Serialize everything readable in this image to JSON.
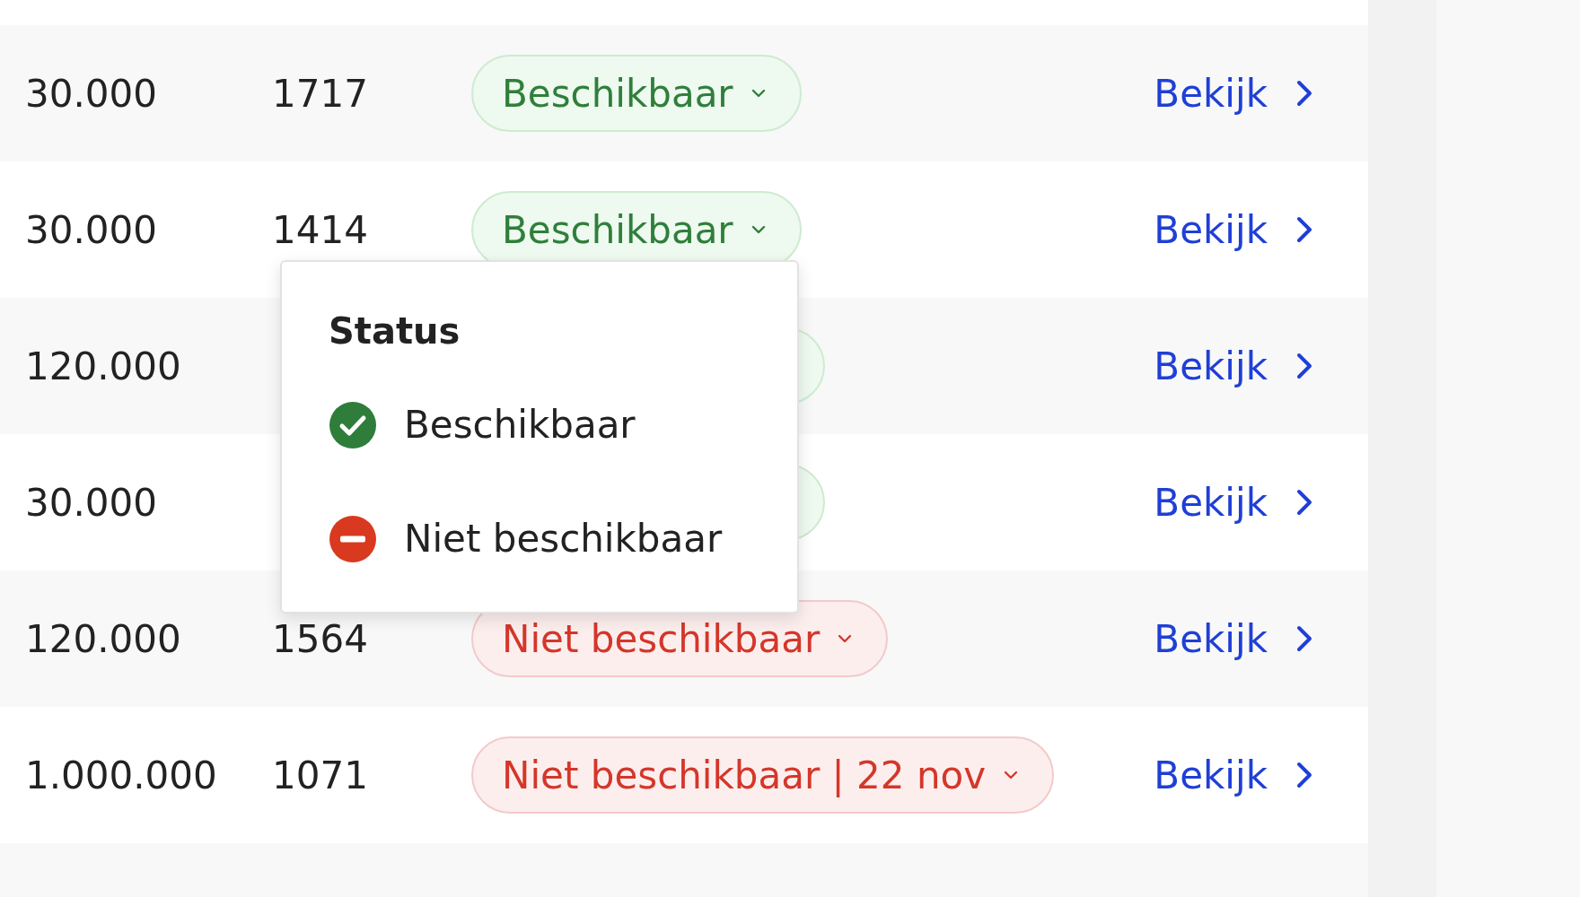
{
  "rows": [
    {
      "amount": "30.000",
      "number": "1717",
      "status": {
        "kind": "available",
        "label": "Beschikbaar"
      },
      "link": "Bekijk"
    },
    {
      "amount": "30.000",
      "number": "1414",
      "status": {
        "kind": "available",
        "label": "Beschikbaar"
      },
      "link": "Bekijk"
    },
    {
      "amount": "120.000",
      "status": {
        "kind": "available"
      },
      "link": "Bekijk"
    },
    {
      "amount": "30.000",
      "status": {
        "kind": "available"
      },
      "link": "Bekijk"
    },
    {
      "amount": "120.000",
      "number": "1564",
      "status": {
        "kind": "unavailable",
        "label": "Niet beschikbaar"
      },
      "link": "Bekijk"
    },
    {
      "amount": "1.000.000",
      "number": "1071",
      "status": {
        "kind": "unavailable",
        "label": "Niet beschikbaar | 22 nov"
      },
      "link": "Bekijk"
    }
  ],
  "status_menu": {
    "title": "Status",
    "options": [
      {
        "kind": "available",
        "label": "Beschikbaar"
      },
      {
        "kind": "unavailable",
        "label": "Niet beschikbaar"
      }
    ]
  }
}
